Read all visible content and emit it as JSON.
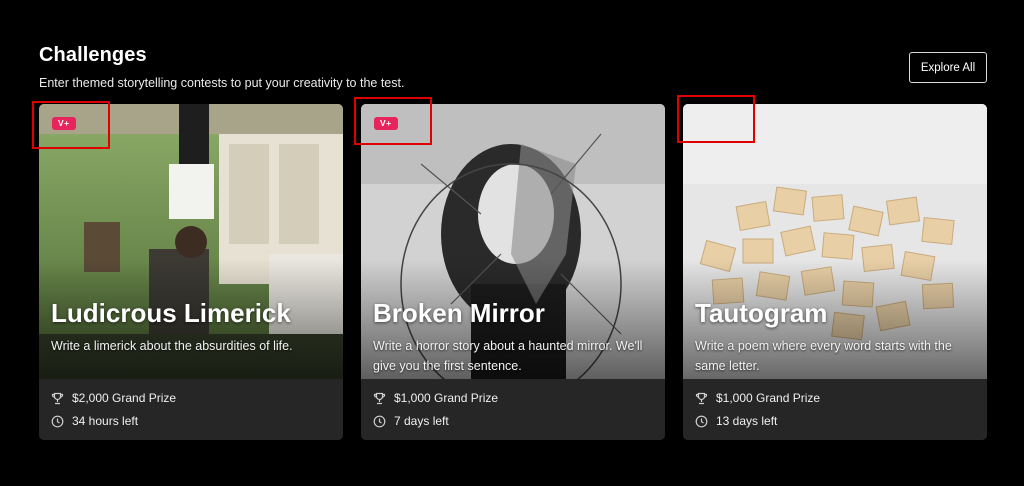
{
  "section": {
    "title": "Challenges",
    "subtitle": "Enter themed storytelling contests to put your creativity to the test.",
    "explore_label": "Explore All"
  },
  "cards": [
    {
      "badge": "V+",
      "title": "Ludicrous Limerick",
      "description": "Write a limerick about the absurdities of life.",
      "prize": "$2,000 Grand Prize",
      "time_left": "34 hours left"
    },
    {
      "badge": "V+",
      "title": "Broken Mirror",
      "description": "Write a horror story about a haunted mirror. We'll give you the first sentence.",
      "prize": "$1,000 Grand Prize",
      "time_left": "7 days left"
    },
    {
      "badge": "",
      "title": "Tautogram",
      "description": "Write a poem where every word starts with the same letter.",
      "prize": "$1,000 Grand Prize",
      "time_left": "13 days left"
    }
  ],
  "colors": {
    "background": "#000000",
    "card": "#262626",
    "badge": "#e8245c",
    "annotation": "#e10000"
  },
  "icons": [
    "trophy-icon",
    "clock-icon"
  ]
}
